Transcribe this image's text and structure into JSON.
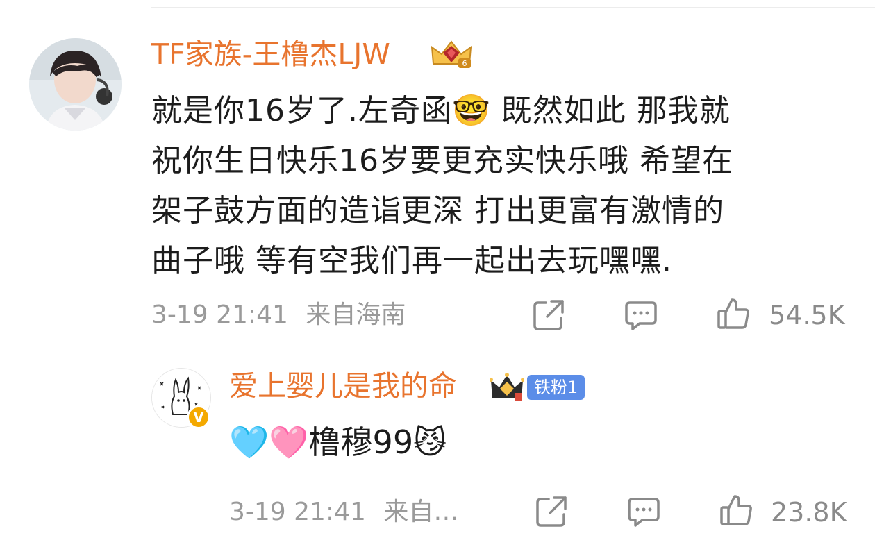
{
  "main_comment": {
    "username": "TF家族-王橹杰LJW",
    "text_lines": [
      "就是你16岁了.左奇函🤓  既然如此 那我就",
      "祝你生日快乐16岁要更充实快乐哦 希望在",
      "架子鼓方面的造诣更深 打出更富有激情的",
      "曲子哦  等有空我们再一起出去玩嘿嘿."
    ],
    "timestamp": "3-19 21:41",
    "location": "来自海南",
    "like_count": "54.5K",
    "badge_icon": "crown-level-badge",
    "badge_level": "6"
  },
  "reply": {
    "username": "爱上婴儿是我的命",
    "fan_badge_label": "铁粉1",
    "vip_letter": "V",
    "text": "🩵🩷橹穆99😼",
    "timestamp": "3-19 21:41",
    "location": "来自…",
    "like_count": "23.8K"
  },
  "colors": {
    "username": "#e8742e",
    "meta": "#9a9a9a",
    "fan_badge": "#5b8de8",
    "vip": "#f4a900"
  }
}
